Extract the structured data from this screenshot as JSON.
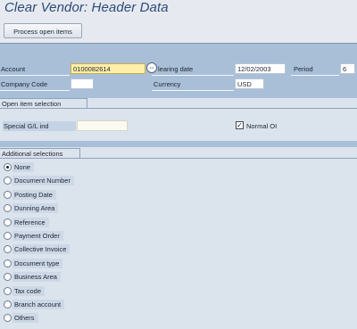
{
  "window": {
    "title": "Clear Vendor: Header Data"
  },
  "toolbar": {
    "process_open_items_label": "Process open items"
  },
  "header": {
    "account_label": "Account",
    "account_value": "0100082614",
    "clearing_date_label": "learing date",
    "clearing_date_value": "12/02/2003",
    "period_label": "Period",
    "period_value": "6",
    "company_code_label": "Company Code",
    "company_code_value": "",
    "currency_label": "Currency",
    "currency_value": "USD",
    "matchcode_icon": "matchcode-icon"
  },
  "open_item_selection": {
    "tab_label": "Open item selection",
    "special_gl_label": "Special G/L ind",
    "special_gl_value": "",
    "normal_oi_label": "Normal OI",
    "normal_oi_checked": true,
    "check_mark": "✓"
  },
  "additional_selections": {
    "tab_label": "Additional selections",
    "selected": "None",
    "options": [
      {
        "label": "None"
      },
      {
        "label": "Document Number"
      },
      {
        "label": "Posting Date"
      },
      {
        "label": "Dunning Area"
      },
      {
        "label": "Reference"
      },
      {
        "label": "Payment Order"
      },
      {
        "label": "Collective Invoice"
      },
      {
        "label": "Document type"
      },
      {
        "label": "Business Area"
      },
      {
        "label": "Tax code"
      },
      {
        "label": "Branch account"
      },
      {
        "label": "Others"
      }
    ]
  },
  "colors": {
    "title": "#2c4a78",
    "header_band": "#a9bfd8",
    "required_field": "#ffefaa",
    "section_bg": "#dbe3ed"
  }
}
